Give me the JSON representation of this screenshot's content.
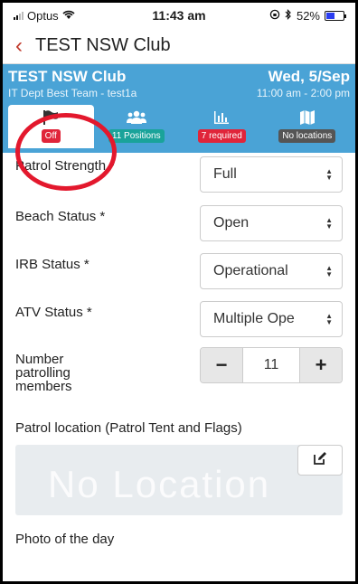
{
  "status_bar": {
    "carrier": "Optus",
    "time": "11:43 am",
    "battery": "52%"
  },
  "nav": {
    "title": "TEST NSW Club"
  },
  "header": {
    "club": "TEST NSW Club",
    "date": "Wed, 5/Sep",
    "team": "IT Dept Best Team - test1a",
    "time_range": "11:00 am - 2:00 pm",
    "tabs": [
      {
        "icon": "flag-icon",
        "badge": "Off",
        "badge_color": "#e0253a"
      },
      {
        "icon": "people-icon",
        "badge": "11 Positions",
        "badge_color": "#1aa39a"
      },
      {
        "icon": "bar-chart-icon",
        "badge": "7 required",
        "badge_color": "#e0253a"
      },
      {
        "icon": "map-icon",
        "badge": "No locations",
        "badge_color": "#555555"
      }
    ]
  },
  "form": {
    "patrol_strength": {
      "label": "Patrol Strength *",
      "value": "Full"
    },
    "beach_status": {
      "label": "Beach Status *",
      "value": "Open"
    },
    "irb_status": {
      "label": "IRB Status *",
      "value": "Operational"
    },
    "atv_status": {
      "label": "ATV Status *",
      "value": "Multiple Ope"
    },
    "patrolling_members": {
      "label_lines": [
        "Number",
        "patrolling",
        "members"
      ],
      "value": "11",
      "minus": "−",
      "plus": "+"
    },
    "patrol_location": {
      "label": "Patrol location (Patrol Tent and Flags)",
      "placeholder": "No Location"
    },
    "photo": {
      "label": "Photo of the day"
    }
  },
  "colors": {
    "header_bg": "#4aa3d6",
    "accent": "#c0392b",
    "highlight_circle": "#e3182d"
  }
}
